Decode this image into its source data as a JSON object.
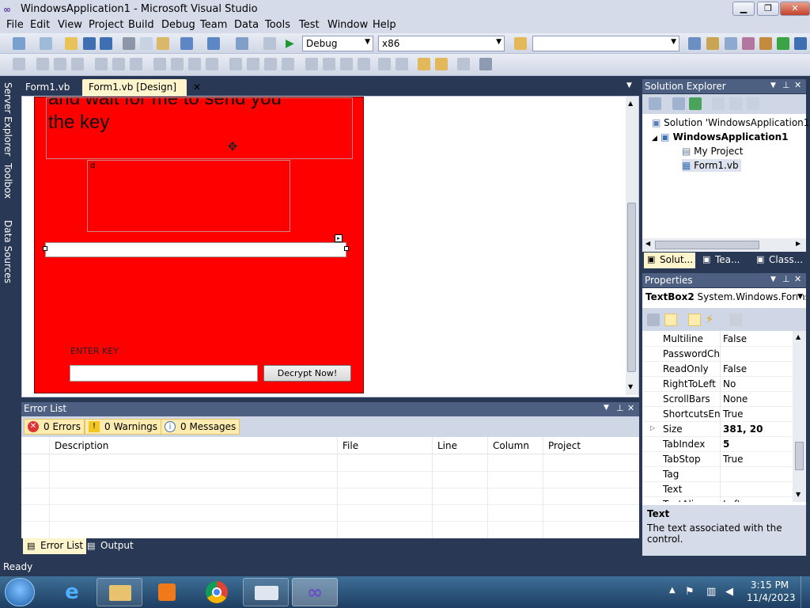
{
  "window": {
    "title": "WindowsApplication1 - Microsoft Visual Studio"
  },
  "menu": [
    "File",
    "Edit",
    "View",
    "Project",
    "Build",
    "Debug",
    "Team",
    "Data",
    "Tools",
    "Test",
    "Window",
    "Help"
  ],
  "toolbar": {
    "config": "Debug",
    "platform": "x86",
    "find": ""
  },
  "left_rail": [
    "Server Explorer",
    "Toolbox",
    "Data Sources"
  ],
  "doc_tabs": [
    {
      "label": "Form1.vb"
    },
    {
      "label": "Form1.vb [Design]"
    }
  ],
  "form": {
    "big_label_line1": "and wait for me to send you",
    "big_label_line2": "the key",
    "small_label": "d",
    "enter_key_label": "ENTER KEY",
    "key_input_value": "",
    "decrypt_button": "Decrypt Now!"
  },
  "error_list": {
    "title": "Error List",
    "errors": "0 Errors",
    "warnings": "0 Warnings",
    "messages": "0 Messages",
    "columns": [
      "Description",
      "File",
      "Line",
      "Column",
      "Project"
    ]
  },
  "bottom_tabs": [
    "Error List",
    "Output"
  ],
  "solution_explorer": {
    "title": "Solution Explorer",
    "solution": "Solution 'WindowsApplication1'",
    "project": "WindowsApplication1",
    "items": [
      "My Project",
      "Form1.vb"
    ],
    "tabs": [
      "Solut...",
      "Tea...",
      "Class..."
    ]
  },
  "properties": {
    "title": "Properties",
    "object_name": "TextBox2",
    "object_type": "System.Windows.Forms",
    "rows": [
      {
        "name": "Multiline",
        "value": "False",
        "bold": false
      },
      {
        "name": "PasswordCha",
        "value": "",
        "bold": false
      },
      {
        "name": "ReadOnly",
        "value": "False",
        "bold": false
      },
      {
        "name": "RightToLeft",
        "value": "No",
        "bold": false
      },
      {
        "name": "ScrollBars",
        "value": "None",
        "bold": false
      },
      {
        "name": "ShortcutsEnal",
        "value": "True",
        "bold": false
      },
      {
        "name": "Size",
        "value": "381, 20",
        "bold": true
      },
      {
        "name": "TabIndex",
        "value": "5",
        "bold": true
      },
      {
        "name": "TabStop",
        "value": "True",
        "bold": false
      },
      {
        "name": "Tag",
        "value": "",
        "bold": false
      },
      {
        "name": "Text",
        "value": "",
        "bold": false
      },
      {
        "name": "TextAlign",
        "value": "Left",
        "bold": false
      }
    ],
    "desc_title": "Text",
    "desc_text": "The text associated with the control."
  },
  "status": {
    "text": "Ready"
  },
  "taskbar": {
    "time": "3:15 PM",
    "date": "11/4/2023"
  },
  "colors": {
    "accent": "#4d6082",
    "form_bg": "#ff0000",
    "chrome": "#293955"
  }
}
